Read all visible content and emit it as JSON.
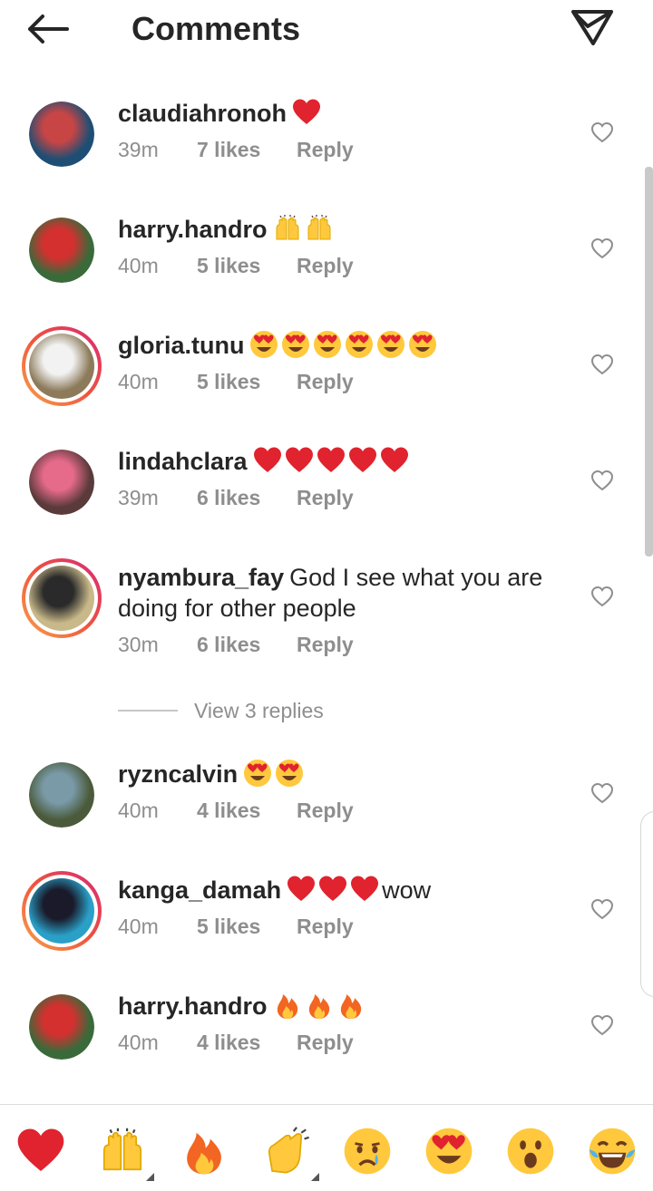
{
  "header": {
    "title": "Comments",
    "back_icon": "arrow-left-icon",
    "share_icon": "paper-plane-icon"
  },
  "comments": [
    {
      "username": "claudiahronoh",
      "text": "",
      "emojis": [
        "heart"
      ],
      "time": "39m",
      "likes": "7 likes",
      "reply": "Reply",
      "story_ring": false,
      "avatar_colors": [
        "#1e4e74",
        "#c84545"
      ]
    },
    {
      "username": "harry.handro",
      "text": "",
      "emojis": [
        "raised-hands",
        "raised-hands"
      ],
      "time": "40m",
      "likes": "5 likes",
      "reply": "Reply",
      "story_ring": false,
      "avatar_colors": [
        "#3a6a3a",
        "#d43030"
      ]
    },
    {
      "username": "gloria.tunu",
      "text": "",
      "emojis": [
        "heart-eyes",
        "heart-eyes",
        "heart-eyes",
        "heart-eyes",
        "heart-eyes",
        "heart-eyes"
      ],
      "time": "40m",
      "likes": "5 likes",
      "reply": "Reply",
      "story_ring": true,
      "avatar_colors": [
        "#8c7a5a",
        "#f2f2f2"
      ]
    },
    {
      "username": "lindahclara",
      "text": "",
      "emojis": [
        "heart",
        "heart",
        "heart",
        "heart",
        "heart"
      ],
      "time": "39m",
      "likes": "6 likes",
      "reply": "Reply",
      "story_ring": false,
      "avatar_colors": [
        "#5a3a3a",
        "#e66a8a"
      ]
    },
    {
      "username": "nyambura_fay",
      "text": "God I see what you are doing for other people",
      "emojis": [],
      "time": "30m",
      "likes": "6 likes",
      "reply": "Reply",
      "story_ring": true,
      "avatar_colors": [
        "#c9b98a",
        "#2a2a2a"
      ]
    },
    {
      "username": "ryzncalvin",
      "text": "",
      "emojis": [
        "heart-eyes",
        "heart-eyes"
      ],
      "time": "40m",
      "likes": "4 likes",
      "reply": "Reply",
      "story_ring": false,
      "avatar_colors": [
        "#4a5a3a",
        "#7a9aa8"
      ]
    },
    {
      "username": "kanga_damah",
      "text": "wow",
      "emojis": [
        "heart",
        "heart",
        "heart"
      ],
      "time": "40m",
      "likes": "5 likes",
      "reply": "Reply",
      "story_ring": true,
      "avatar_colors": [
        "#2aa0c8",
        "#1a1a2a"
      ]
    },
    {
      "username": "harry.handro",
      "text": "",
      "emojis": [
        "fire",
        "fire",
        "fire"
      ],
      "time": "40m",
      "likes": "4 likes",
      "reply": "Reply",
      "story_ring": false,
      "avatar_colors": [
        "#3a6a3a",
        "#d43030"
      ]
    }
  ],
  "view_replies": "View 3 replies",
  "emoji_bar": [
    "heart",
    "raised-hands",
    "fire",
    "clapping-hands",
    "crying-face",
    "heart-eyes",
    "astonished-face",
    "tears-of-joy"
  ],
  "colors": {
    "primary_text": "#262626",
    "secondary_text": "#8e8e8e",
    "heart_red": "#e0232e",
    "emoji_yellow": "#ffc83d"
  }
}
